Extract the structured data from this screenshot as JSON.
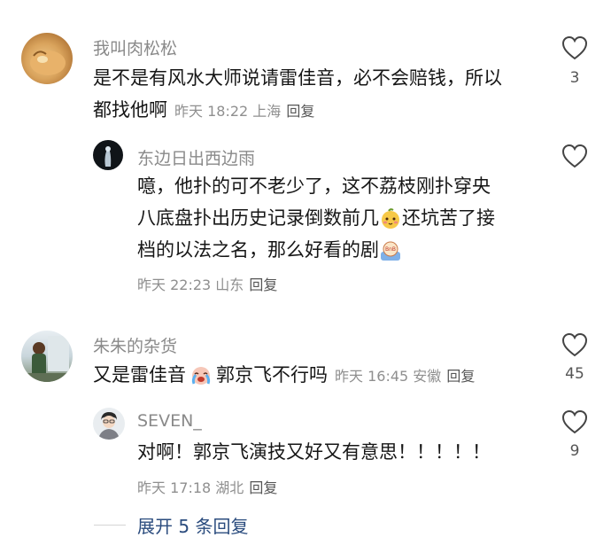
{
  "comments": [
    {
      "username": "我叫肉松松",
      "text_line1": "是不是有风水大师说请雷佳音，必不会赔钱，所以",
      "text_line2": "都找他啊",
      "time": "昨天 18:22",
      "location": "上海",
      "reply_label": "回复",
      "likes": "3"
    },
    {
      "username": "东边日出西边雨",
      "text_line1": "噫，他扑的可不老少了，这不荔枝刚扑穿央",
      "text_line2a": "八底盘扑出历史记录倒数前几",
      "text_line2b": "还坑苦了接",
      "text_line3": "档的以法之名，那么好看的剧",
      "time": "昨天 22:23",
      "location": "山东",
      "reply_label": "回复"
    },
    {
      "username": "朱朱的杂货",
      "text_a": "又是雷佳音",
      "text_b": "郭京飞不行吗",
      "time": "昨天 16:45",
      "location": "安徽",
      "reply_label": "回复",
      "likes": "45"
    },
    {
      "username": "SEVEN_",
      "text": "对啊！郭京飞演技又好又有意思！！！！！",
      "time": "昨天 17:18",
      "location": "湖北",
      "reply_label": "回复",
      "likes": "9"
    }
  ],
  "expand_label": "展开 5 条回复",
  "colors": {
    "username": "#8a8a8a",
    "text": "#161616",
    "meta": "#8f8f8f",
    "expand": "#2b4c7e"
  },
  "icons": [
    "heart-outline-icon",
    "blushing-mango-emoji",
    "crying-emoji",
    "bnb-sticker-emoji"
  ]
}
